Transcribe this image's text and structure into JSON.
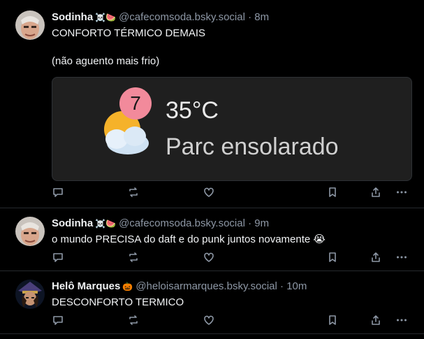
{
  "colors": {
    "background": "#000000",
    "text": "#f1f3f5",
    "muted": "#8d97a5",
    "divider": "#26292e",
    "badge": "#f28a9b"
  },
  "posts": [
    {
      "author_name": "Sodinha",
      "author_emojis": "☠️🍉",
      "handle": "@cafecomsoda.bsky.social",
      "separator": "·",
      "time": "8m",
      "text": "CONFORTO TÉRMICO DEMAIS\n\n(não aguento mais frio)",
      "embed": {
        "badge": "7",
        "temperature": "35°C",
        "description": "Parc ensolarado"
      },
      "actions": [
        "reply-icon",
        "repost-icon",
        "like-icon",
        "bookmark-icon",
        "share-icon",
        "more-icon"
      ]
    },
    {
      "author_name": "Sodinha",
      "author_emojis": "☠️🍉",
      "handle": "@cafecomsoda.bsky.social",
      "separator": "·",
      "time": "9m",
      "text": "o mundo PRECISA do daft e do punk juntos novamente 😭",
      "actions": [
        "reply-icon",
        "repost-icon",
        "like-icon",
        "bookmark-icon",
        "share-icon",
        "more-icon"
      ]
    },
    {
      "author_name": "Helô Marques",
      "author_emojis": "🎃",
      "handle": "@heloisarmarques.bsky.social",
      "separator": "·",
      "time": "10m",
      "text": "DESCONFORTO TERMICO",
      "actions": [
        "reply-icon",
        "repost-icon",
        "like-icon",
        "bookmark-icon",
        "share-icon",
        "more-icon"
      ]
    }
  ]
}
